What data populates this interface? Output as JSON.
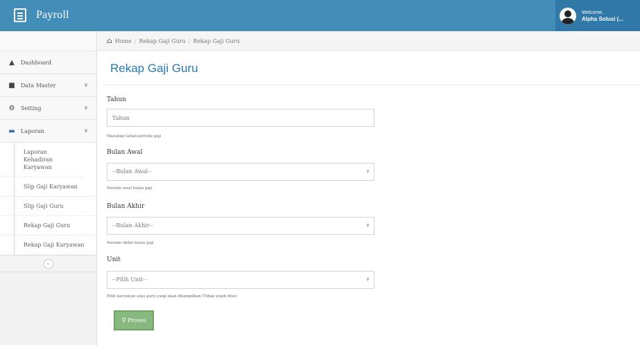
{
  "app": {
    "brand": "Payroll"
  },
  "user": {
    "welcome": "Welcome,",
    "name": "Alpha Solusi (..."
  },
  "sidebar": {
    "items": [
      {
        "label": "Dashboard",
        "icon": "dashboard-icon"
      },
      {
        "label": "Data Master",
        "icon": "user-icon"
      },
      {
        "label": "Setting",
        "icon": "gears-icon"
      },
      {
        "label": "Laporan",
        "icon": "book-icon"
      }
    ],
    "submenu": [
      "Laporan Kehadiran Karyawan",
      "Slip Gaji Karyawan",
      "Slip Gaji Guru",
      "Rekap Gaji Guru",
      "Rekap Gaji Karyawan"
    ]
  },
  "breadcrumb": [
    "Home",
    "Rekap Gaji Guru",
    "Rekap Gaji Guru"
  ],
  "page": {
    "title": "Rekap Gaji Guru"
  },
  "form": {
    "tahun": {
      "label": "Tahun",
      "placeholder": "Tahun",
      "help": "Masukan tahun periode gaji"
    },
    "bulan_awal": {
      "label": "Bulan Awal",
      "value": "--Bulan Awal--",
      "help": "Periode awal bulan gaji"
    },
    "bulan_akhir": {
      "label": "Bulan Akhir",
      "value": "--Bulan Akhir--",
      "help": "Periode Akhir bulan gaji"
    },
    "unit": {
      "label": "Unit",
      "value": "--Pilih Unit--",
      "help": "Pilih karyawan atau guru yang akan ditampilkan (Tidak wajib diisi)"
    },
    "submit_label": "Proses"
  },
  "colors": {
    "navbar": "#438eb9",
    "accent": "#2679b5",
    "button": "#87b87f"
  }
}
